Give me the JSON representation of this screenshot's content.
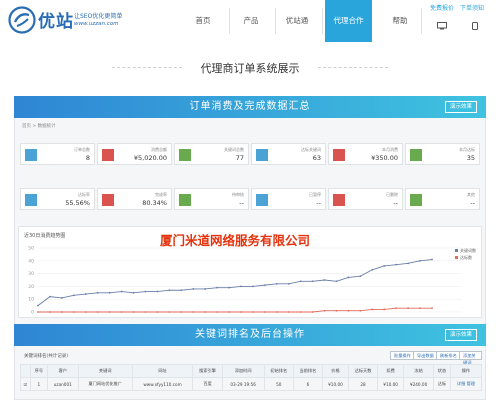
{
  "brand": {
    "name": "优站",
    "tagline": "让SEO优化更简单",
    "url": "www.uzzan.com",
    "color": "#2a6db5"
  },
  "nav": {
    "items": [
      {
        "label": "首页",
        "active": false
      },
      {
        "label": "产品",
        "active": false
      },
      {
        "label": "优站通",
        "active": false
      },
      {
        "label": "代理合作",
        "active": true
      },
      {
        "label": "帮助",
        "active": false
      }
    ],
    "accent": "#2aa5dc"
  },
  "top_links": {
    "register": "免费报价",
    "download": "下单须知"
  },
  "page": {
    "heading": "代理商订单系统展示"
  },
  "orders_panel": {
    "title": "订单消费及完成数据汇总",
    "button": "演示效果",
    "breadcrumb": "首页   >   数据统计",
    "row1": [
      {
        "label": "订单总数",
        "value": "8",
        "icon": "cart-icon",
        "color": "#4aa3d4"
      },
      {
        "label": "消费总额",
        "value": "¥5,020.00",
        "icon": "money-icon",
        "color": "#d9534f"
      },
      {
        "label": "关键词总数",
        "value": "77",
        "icon": "key-icon",
        "color": "#6aaa4f"
      },
      {
        "label": "达标关键词",
        "value": "63",
        "icon": "check-icon",
        "color": "#4aa3d4"
      },
      {
        "label": "本月消费",
        "value": "¥350.00",
        "icon": "money-icon",
        "color": "#d9534f"
      },
      {
        "label": "本月达标",
        "value": "35",
        "icon": "chart-icon",
        "color": "#6aaa4f"
      }
    ],
    "row2": [
      {
        "label": "达标率",
        "value": "55.56%",
        "icon": "percent-icon",
        "color": "#4aa3d4"
      },
      {
        "label": "完成率",
        "value": "80.34%",
        "icon": "percent-icon",
        "color": "#d9534f"
      },
      {
        "label": "待审核",
        "value": "--",
        "icon": "clock-icon",
        "color": "#6aaa4f"
      },
      {
        "label": "已暂停",
        "value": "--",
        "icon": "pause-icon",
        "color": "#4aa3d4"
      },
      {
        "label": "已删除",
        "value": "--",
        "icon": "trash-icon",
        "color": "#d9534f"
      },
      {
        "label": "其他",
        "value": "--",
        "icon": "more-icon",
        "color": "#6aaa4f"
      }
    ]
  },
  "watermark": "厦门米道网络服务有限公司",
  "chart_data": {
    "type": "line",
    "title": "近30日消费趋势图",
    "ylim": [
      0,
      50
    ],
    "yticks": [
      "50",
      "40",
      "30",
      "20",
      "10",
      "0"
    ],
    "grid": true,
    "legend_position": "top-right",
    "series": [
      {
        "name": "关键词数",
        "color": "#6b7fa8",
        "values": [
          5,
          12,
          11,
          13,
          14,
          15,
          15,
          16,
          15,
          16,
          16,
          17,
          17,
          18,
          18,
          19,
          19,
          20,
          20,
          21,
          22,
          22,
          24,
          24,
          25,
          24,
          27,
          28,
          33,
          36,
          37,
          38,
          40,
          41
        ]
      },
      {
        "name": "达标数",
        "color": "#e06a5b",
        "values": [
          0,
          0,
          0,
          0,
          0,
          0,
          0,
          0,
          0,
          0,
          0,
          0,
          0,
          0,
          0,
          0,
          0,
          0,
          0,
          0,
          0,
          0,
          0,
          0,
          1,
          1,
          1,
          1,
          2,
          2,
          3,
          3,
          3,
          3
        ]
      }
    ]
  },
  "keywords_panel": {
    "title": "关键词排名及后台操作",
    "button": "演示效果",
    "table_title": "关键词排名(共计记录)",
    "buttons": [
      "批量操作",
      "导出数据",
      "刷新排名",
      "添加关键词"
    ],
    "columns": [
      "",
      "序号",
      "客户",
      "关键词",
      "网址",
      "搜索引擎",
      "添加时间",
      "初始排名",
      "当前排名",
      "价格",
      "达标天数",
      "扣费",
      "冻结",
      "状态",
      "操作"
    ],
    "rows": [
      [
        "☑",
        "1",
        "uzan001",
        "厦门网站优化推广",
        "www.xfyy110.com",
        "百度",
        "03-29 19:56",
        "50",
        "6",
        "¥10.00",
        "28",
        "¥10.00",
        "¥240.00",
        "达标",
        "详细 管理"
      ]
    ]
  }
}
